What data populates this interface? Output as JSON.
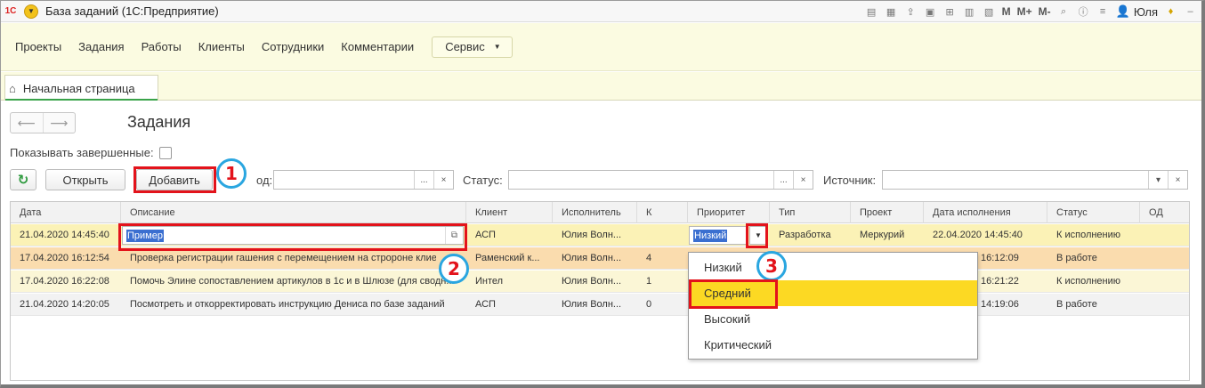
{
  "window": {
    "title": "База заданий  (1С:Предприятие)",
    "toolbar_text": [
      "M",
      "M+",
      "M-"
    ],
    "user": "Юля"
  },
  "menubar": {
    "items": [
      "Проекты",
      "Задания",
      "Работы",
      "Клиенты",
      "Сотрудники",
      "Комментарии"
    ],
    "service_label": "Сервис"
  },
  "tabs": [
    {
      "label": "Начальная страница"
    }
  ],
  "page": {
    "title": "Задания",
    "show_completed_label": "Показывать завершенные:"
  },
  "toolbar": {
    "open_label": "Открыть",
    "add_label": "Добавить",
    "code_label": "од:",
    "status_label": "Статус:",
    "source_label": "Источник:",
    "field_btn": "...",
    "clear_btn": "×"
  },
  "table": {
    "columns": [
      "Дата",
      "Описание",
      "Клиент",
      "Исполнитель",
      "К",
      "Приоритет",
      "Тип",
      "Проект",
      "Дата исполнения",
      "Статус",
      "ОД"
    ],
    "rows": [
      {
        "date": "21.04.2020 14:45:40",
        "desc": "Пример",
        "client": "АСП",
        "exec": "Юлия Волн...",
        "k": "",
        "prio": "Низкий",
        "type": "Разработка",
        "project": "Меркурий",
        "due": "22.04.2020 14:45:40",
        "status": "К исполнению",
        "od": ""
      },
      {
        "date": "17.04.2020 16:12:54",
        "desc": "Проверка регистрации гашения с перемещением на стророне клиент",
        "client": "Раменский к...",
        "exec": "Юлия Волн...",
        "k": "4",
        "prio": "",
        "type": "",
        "project": "",
        "due": "16:12:09",
        "status": "В работе",
        "od": ""
      },
      {
        "date": "17.04.2020 16:22:08",
        "desc": "Помочь Элине сопоставлением артикулов в 1с и в Шлюзе (для сводн...",
        "client": "Интел",
        "exec": "Юлия Волн...",
        "k": "1",
        "prio": "",
        "type": "",
        "project": "",
        "due": "16:21:22",
        "status": "К исполнению",
        "od": ""
      },
      {
        "date": "21.04.2020 14:20:05",
        "desc": "Посмотреть и откорректировать инструкцию Дениса по базе заданий",
        "client": "АСП",
        "exec": "Юлия Волн...",
        "k": "0",
        "prio": "",
        "type": "",
        "project": "",
        "due": "14:19:06",
        "status": "В работе",
        "od": ""
      }
    ]
  },
  "priority_dropdown": {
    "options": [
      "Низкий",
      "Средний",
      "Высокий",
      "Критический"
    ],
    "selected": "Средний"
  },
  "annotations": {
    "badges": [
      "1",
      "2",
      "3"
    ],
    "box_color": "#e3131b",
    "badge_ring_color": "#2aa6e0"
  },
  "colors": {
    "menubar_bg": "#fbfbe1",
    "active_row": "#fbf2b6",
    "dropdown_selected": "#fcd923"
  }
}
